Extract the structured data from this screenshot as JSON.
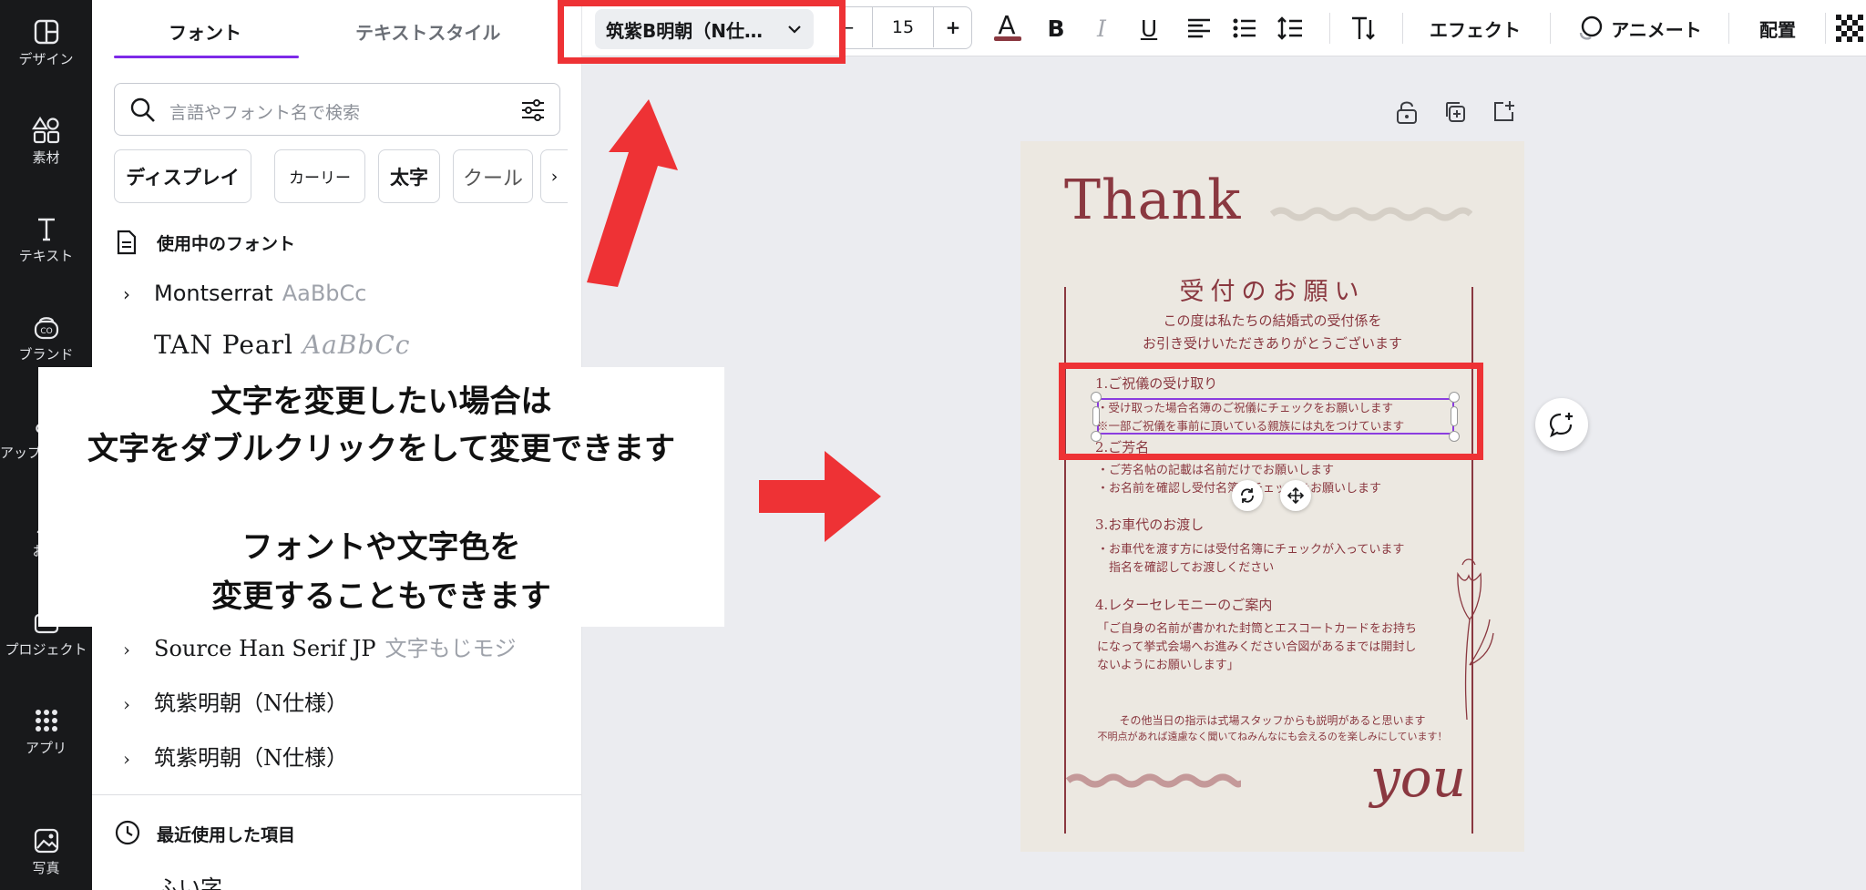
{
  "rail": {
    "items": [
      {
        "label": "デザイン",
        "icon": "design-icon"
      },
      {
        "label": "素材",
        "icon": "elements-icon"
      },
      {
        "label": "テキスト",
        "icon": "text-icon"
      },
      {
        "label": "ブランド",
        "icon": "brand-icon"
      },
      {
        "label": "アップ",
        "icon": "upload-icon"
      },
      {
        "label": "お絵",
        "icon": "draw-icon"
      },
      {
        "label": "プロジェクト",
        "icon": "projects-icon"
      },
      {
        "label": "アプリ",
        "icon": "apps-icon"
      },
      {
        "label": "写真",
        "icon": "photos-icon"
      }
    ]
  },
  "panel": {
    "tabs": [
      "フォント",
      "テキストスタイル"
    ],
    "search_placeholder": "言語やフォント名で検索",
    "chips": [
      "ディスプレイ",
      "カーリー",
      "太字",
      "クール"
    ],
    "in_use_heading": "使用中のフォント",
    "fonts_top": [
      {
        "name": "Montserrat",
        "sample": "AaBbCc"
      },
      {
        "name": "TAN Pearl",
        "sample": "AaBbCc"
      }
    ],
    "fonts_bottom": [
      {
        "name": "Source Han Serif JP",
        "sample": "文字もじモジ"
      },
      {
        "name": "筑紫明朝（N仕様）",
        "sample": ""
      },
      {
        "name": "筑紫明朝（N仕様）",
        "sample": ""
      }
    ],
    "recent_heading": "最近使用した項目",
    "recent_partial": "ふい字"
  },
  "toolbar": {
    "font_name": "筑紫B明朝（N仕…",
    "minus": "−",
    "size": "15",
    "plus": "+",
    "color_letter": "A",
    "bold": "B",
    "italic": "I",
    "underline": "U",
    "effects": "エフェクト",
    "animate": "アニメート",
    "position": "配置",
    "text_color_hex": "#8a3840"
  },
  "card": {
    "thank": "Thank",
    "you": "you",
    "heading": "受付のお願い",
    "intro": [
      "この度は私たちの結婚式の受付係を",
      "お引き受けいただきありがとうございます"
    ],
    "s1_title": "1.ご祝儀の受け取り",
    "s1_lines": [
      "・受け取った場合名簿のご祝儀にチェックをお願いします",
      "※一部ご祝儀を事前に頂いている親族には丸をつけています"
    ],
    "s2_title": "2.ご芳名",
    "s2_lines": [
      "・ご芳名帖の記載は名前だけでお願いします",
      "・お名前を確認し受付名簿にチェックをお願いします"
    ],
    "s3_title": "3.お車代のお渡し",
    "s3_lines": [
      "・お車代を渡す方には受付名簿にチェックが入っています",
      "　指名を確認してお渡しください"
    ],
    "s4_title": "4.レターセレモニーのご案内",
    "s4_lines": [
      "「ご自身の名前が書かれた封筒とエスコートカードをお持ち",
      "になって挙式会場へお進みください合図があるまでは開封し",
      "ないようにお願いします」"
    ],
    "footer": [
      "その他当日の指示は式場スタッフからも説明があると思います",
      "不明点があれば遠慮なく聞いてねみんなにも会えるのを楽しみにしています！"
    ],
    "bg_hex": "#ece8e1"
  },
  "annotation": {
    "lines": [
      "文字を変更したい場合は",
      "文字をダブルクリックをして変更できます",
      "",
      "フォントや文字色を",
      "変更することもできます"
    ],
    "accent_hex": "#ee3235"
  }
}
